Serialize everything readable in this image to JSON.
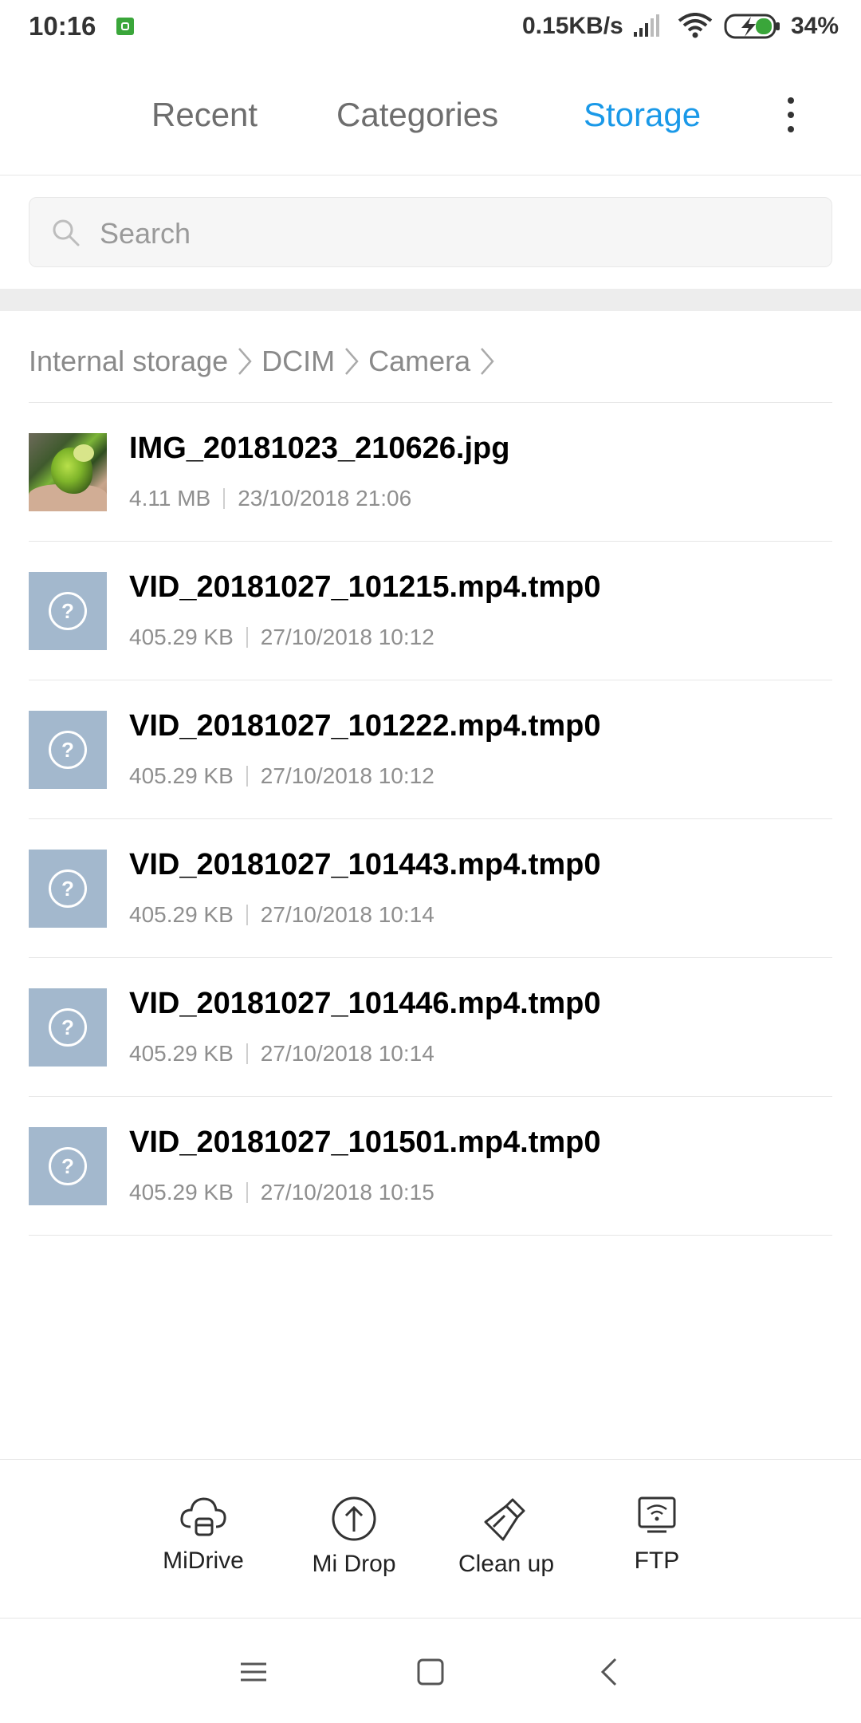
{
  "status_bar": {
    "time": "10:16",
    "net_speed": "0.15KB/s",
    "battery": "34%",
    "icons": [
      "notification-app-icon",
      "signal-icon",
      "wifi-icon",
      "battery-charging-icon"
    ]
  },
  "tabs": [
    {
      "label": "Recent",
      "active": false
    },
    {
      "label": "Categories",
      "active": false
    },
    {
      "label": "Storage",
      "active": true
    }
  ],
  "accent_color": "#1a99e8",
  "search": {
    "placeholder": "Search"
  },
  "breadcrumb": [
    "Internal storage",
    "DCIM",
    "Camera"
  ],
  "files": [
    {
      "name": "IMG_20181023_210626.jpg",
      "size": "4.11 MB",
      "date": "23/10/2018 21:06",
      "thumb": "photo"
    },
    {
      "name": "VID_20181027_101215.mp4.tmp0",
      "size": "405.29 KB",
      "date": "27/10/2018 10:12",
      "thumb": "unknown"
    },
    {
      "name": "VID_20181027_101222.mp4.tmp0",
      "size": "405.29 KB",
      "date": "27/10/2018 10:12",
      "thumb": "unknown"
    },
    {
      "name": "VID_20181027_101443.mp4.tmp0",
      "size": "405.29 KB",
      "date": "27/10/2018 10:14",
      "thumb": "unknown"
    },
    {
      "name": "VID_20181027_101446.mp4.tmp0",
      "size": "405.29 KB",
      "date": "27/10/2018 10:14",
      "thumb": "unknown"
    },
    {
      "name": "VID_20181027_101501.mp4.tmp0",
      "size": "405.29 KB",
      "date": "27/10/2018 10:15",
      "thumb": "unknown"
    }
  ],
  "toolbar": {
    "midrive": "MiDrive",
    "midrop": "Mi Drop",
    "cleanup": "Clean up",
    "ftp": "FTP"
  },
  "unknown_file_glyph": "?"
}
